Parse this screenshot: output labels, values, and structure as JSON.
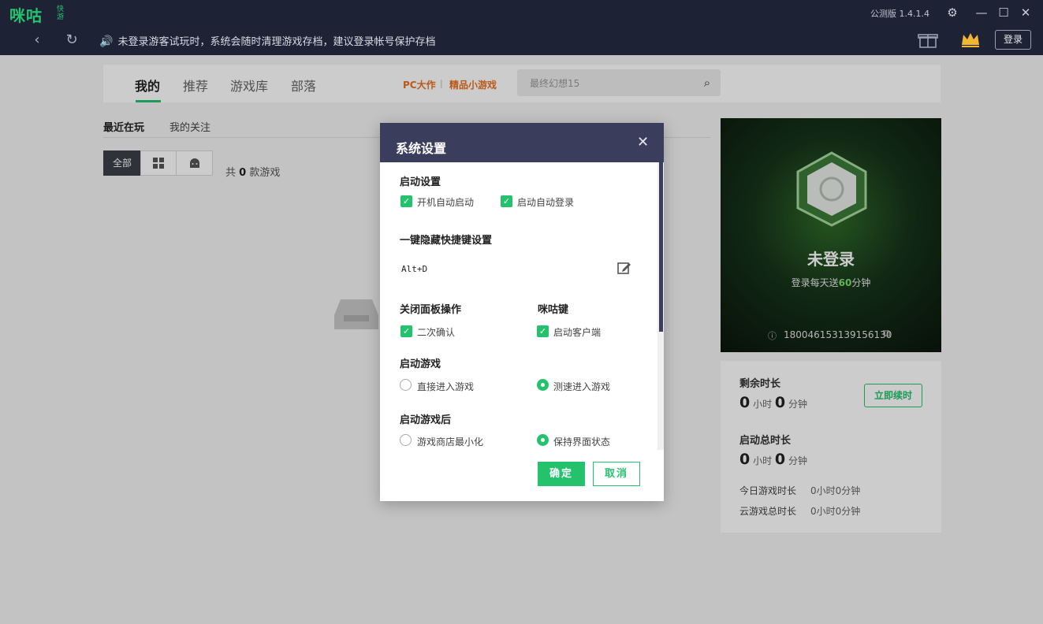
{
  "titlebar": {
    "logo": "咪咕",
    "logo_sub": "快游",
    "version": "公测版 1.4.1.4",
    "notice": "未登录游客试玩时，系统会随时清理游戏存档，建议登录帐号保护存档",
    "login": "登录"
  },
  "nav": {
    "tabs": [
      "我的",
      "推荐",
      "游戏库",
      "部落"
    ],
    "promo": [
      "PC大作",
      "精品小游戏"
    ],
    "promo_sep": "|",
    "search_placeholder": "最终幻想15"
  },
  "library": {
    "subtabs": [
      "最近在玩",
      "我的关注"
    ],
    "filters": {
      "all": "全部"
    },
    "count_prefix": "共",
    "count": "0",
    "count_suffix": "款游戏"
  },
  "profile": {
    "title": "未登录",
    "sub_prefix": "登录每天送",
    "sub_value": "60",
    "sub_suffix": "分钟",
    "id": "180046153139156130"
  },
  "stats": {
    "remaining_label": "剩余时长",
    "renew": "立即续时",
    "total_label": "启动总时长",
    "hours": "0",
    "minutes": "0",
    "hour_unit": "小时",
    "minute_unit": "分钟",
    "today_label": "今日游戏时长",
    "today_value": "0小时0分钟",
    "cloud_label": "云游戏总时长",
    "cloud_value": "0小时0分钟"
  },
  "dialog": {
    "title": "系统设置",
    "startup_title": "启动设置",
    "startup_opt1": "开机自动启动",
    "startup_opt2": "启动自动登录",
    "hotkey_title": "一键隐藏快捷键设置",
    "hotkey_value": "Alt+D",
    "close_title": "关闭面板操作",
    "close_opt": "二次确认",
    "migu_title": "咪咕键",
    "migu_opt": "启动客户端",
    "launch_title": "启动游戏",
    "launch_opt1": "直接进入游戏",
    "launch_opt2": "测速进入游戏",
    "after_title": "启动游戏后",
    "after_opt1": "游戏商店最小化",
    "after_opt2": "保持界面状态",
    "ok": "确定",
    "cancel": "取消"
  },
  "colors": {
    "accent": "#25c26e",
    "titlebar": "#1e2235",
    "dialog_header": "#3a3d5c",
    "promo": "#e9701f"
  }
}
